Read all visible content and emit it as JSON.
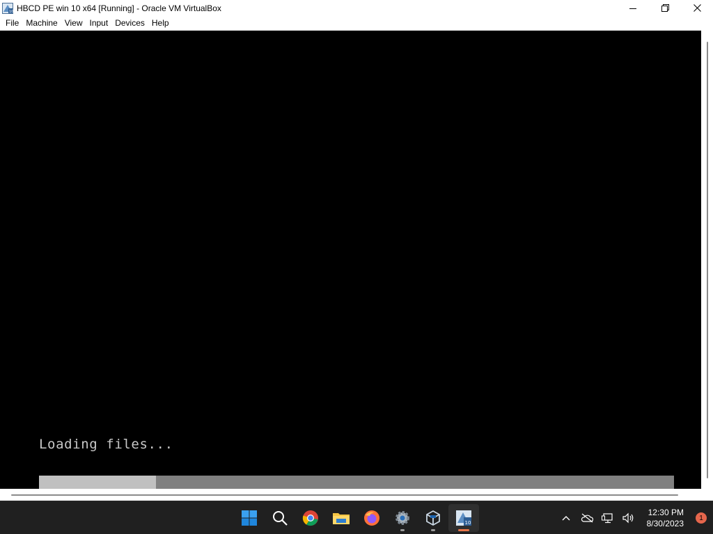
{
  "window": {
    "title": "HBCD PE win 10 x64 [Running] - Oracle VM VirtualBox"
  },
  "menu": {
    "items": [
      "File",
      "Machine",
      "View",
      "Input",
      "Devices",
      "Help"
    ]
  },
  "vm": {
    "loading_text": "Loading files...",
    "progress_fraction": 0.184
  },
  "taskbar": {
    "pinned": [
      {
        "name": "start-icon",
        "active": false,
        "running": false
      },
      {
        "name": "search-icon",
        "active": false,
        "running": false
      },
      {
        "name": "chrome-icon",
        "active": false,
        "running": false
      },
      {
        "name": "file-explorer-icon",
        "active": false,
        "running": false
      },
      {
        "name": "firefox-icon",
        "active": false,
        "running": false
      },
      {
        "name": "settings-icon",
        "active": false,
        "running": true
      },
      {
        "name": "virtualbox-icon",
        "active": false,
        "running": true
      },
      {
        "name": "virtualbox-vm-icon",
        "active": true,
        "running": true
      }
    ],
    "clock_time": "12:30 PM",
    "clock_date": "8/30/2023",
    "notification_count": "1"
  },
  "colors": {
    "taskbar_bg": "#202020",
    "active_indicator": "#e8764a",
    "progress_fill": "#c0c0c0",
    "progress_track": "#808080"
  }
}
